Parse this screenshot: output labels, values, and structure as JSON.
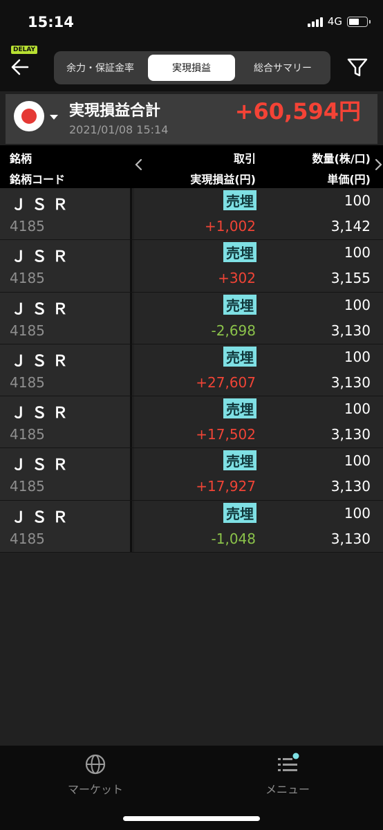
{
  "status_bar": {
    "time": "15:14",
    "network": "4G"
  },
  "header": {
    "delay_badge": "DELAY",
    "tabs": [
      {
        "label": "余力・保証金率"
      },
      {
        "label": "実現損益",
        "selected": true
      },
      {
        "label": "総合サマリー"
      }
    ]
  },
  "summary": {
    "title": "実現損益合計",
    "date": "2021/01/08 15:14",
    "total": "+60,594円"
  },
  "columns": {
    "stock": "銘柄",
    "stock_code": "銘柄コード",
    "trade": "取引",
    "realized_pnl": "実現損益(円)",
    "quantity": "数量(株/口)",
    "unit_price": "単価(円)"
  },
  "rows": [
    {
      "name": "ＪＳＲ",
      "code": "4185",
      "trade": "売埋",
      "pnl": "+1,002",
      "sign": "pos",
      "qty": "100",
      "price": "3,142"
    },
    {
      "name": "ＪＳＲ",
      "code": "4185",
      "trade": "売埋",
      "pnl": "+302",
      "sign": "pos",
      "qty": "100",
      "price": "3,155"
    },
    {
      "name": "ＪＳＲ",
      "code": "4185",
      "trade": "売埋",
      "pnl": "-2,698",
      "sign": "neg",
      "qty": "100",
      "price": "3,130"
    },
    {
      "name": "ＪＳＲ",
      "code": "4185",
      "trade": "売埋",
      "pnl": "+27,607",
      "sign": "pos",
      "qty": "100",
      "price": "3,130"
    },
    {
      "name": "ＪＳＲ",
      "code": "4185",
      "trade": "売埋",
      "pnl": "+17,502",
      "sign": "pos",
      "qty": "100",
      "price": "3,130"
    },
    {
      "name": "ＪＳＲ",
      "code": "4185",
      "trade": "売埋",
      "pnl": "+17,927",
      "sign": "pos",
      "qty": "100",
      "price": "3,130"
    },
    {
      "name": "ＪＳＲ",
      "code": "4185",
      "trade": "売埋",
      "pnl": "-1,048",
      "sign": "neg",
      "qty": "100",
      "price": "3,130"
    }
  ],
  "bottom_nav": {
    "market": "マーケット",
    "menu": "メニュー"
  },
  "colors": {
    "positive": "#f04436",
    "negative": "#8bc34a",
    "trade_badge": "#7fe0e4",
    "delay_badge": "#b8e032"
  }
}
